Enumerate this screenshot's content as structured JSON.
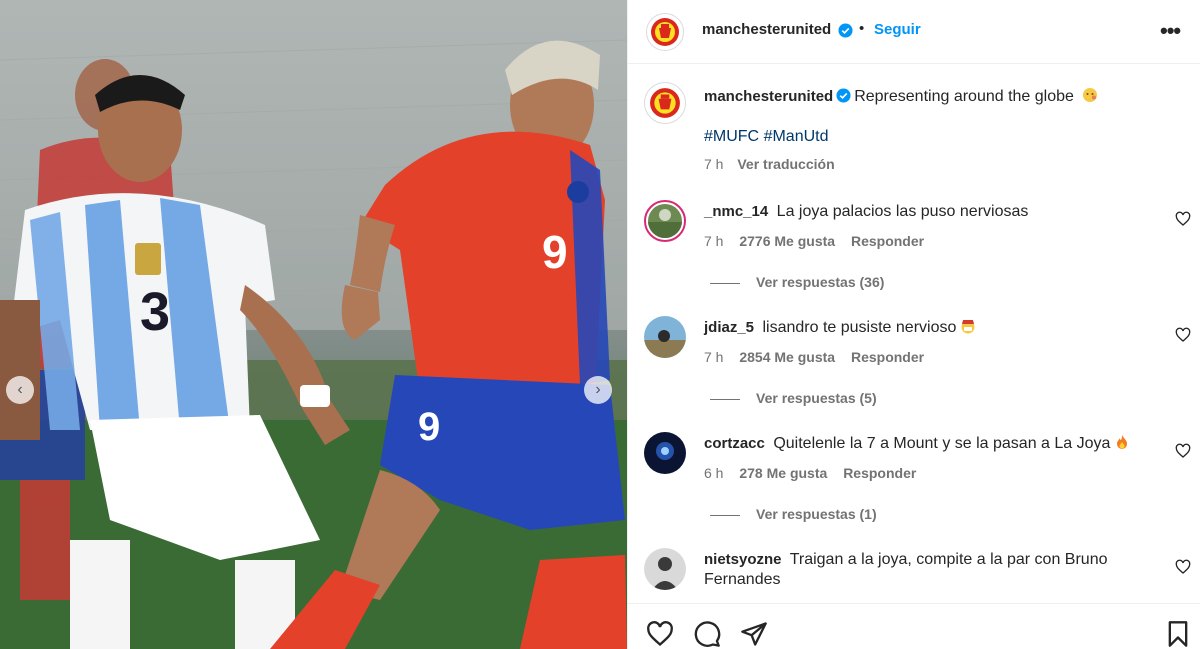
{
  "colors": {
    "link": "#0095f6",
    "hashtag": "#00376b",
    "muted": "#737373",
    "chile_red": "#e4412b",
    "chile_blue": "#2647b8",
    "argentina_blue": "#74a9e6"
  },
  "media": {
    "alt_label": "",
    "prev_icon": "chevron-left-icon",
    "next_icon": "chevron-right-icon",
    "argentina_number": "3",
    "chile_number": "9"
  },
  "header": {
    "username": "manchesterunited",
    "separator": "•",
    "follow_label": "Seguir",
    "more_label": "•••"
  },
  "caption": {
    "username": "manchesterunited",
    "text": "Representing around the globe",
    "emoji": "face-emoji",
    "hashtags": [
      "#MUFC",
      "#ManUtd"
    ],
    "time": "7 h",
    "translate_label": "Ver traducción"
  },
  "comments": [
    {
      "username": "_nmc_14",
      "text": "La joya palacios las puso nerviosas",
      "time": "7 h",
      "likes": "2776 Me gusta",
      "reply_label": "Responder",
      "replies_label": "Ver respuestas (36)"
    },
    {
      "username": "jdiaz_5",
      "text": "lisandro te pusiste nervioso",
      "emoji": "mask-emoji",
      "time": "7 h",
      "likes": "2854 Me gusta",
      "reply_label": "Responder",
      "replies_label": "Ver respuestas (5)"
    },
    {
      "username": "cortzacc",
      "text": "Quitelenle la 7 a Mount y se la pasan a La Joya",
      "emoji": "fire-emoji",
      "time": "6 h",
      "likes": "278 Me gusta",
      "reply_label": "Responder",
      "replies_label": "Ver respuestas (1)"
    },
    {
      "username": "nietsyozne",
      "text": "Traigan a la joya, compite a la par con Bruno Fernandes"
    }
  ],
  "actions": {
    "like_icon": "heart-icon",
    "comment_icon": "comment-icon",
    "share_icon": "share-icon",
    "save_icon": "bookmark-icon"
  }
}
